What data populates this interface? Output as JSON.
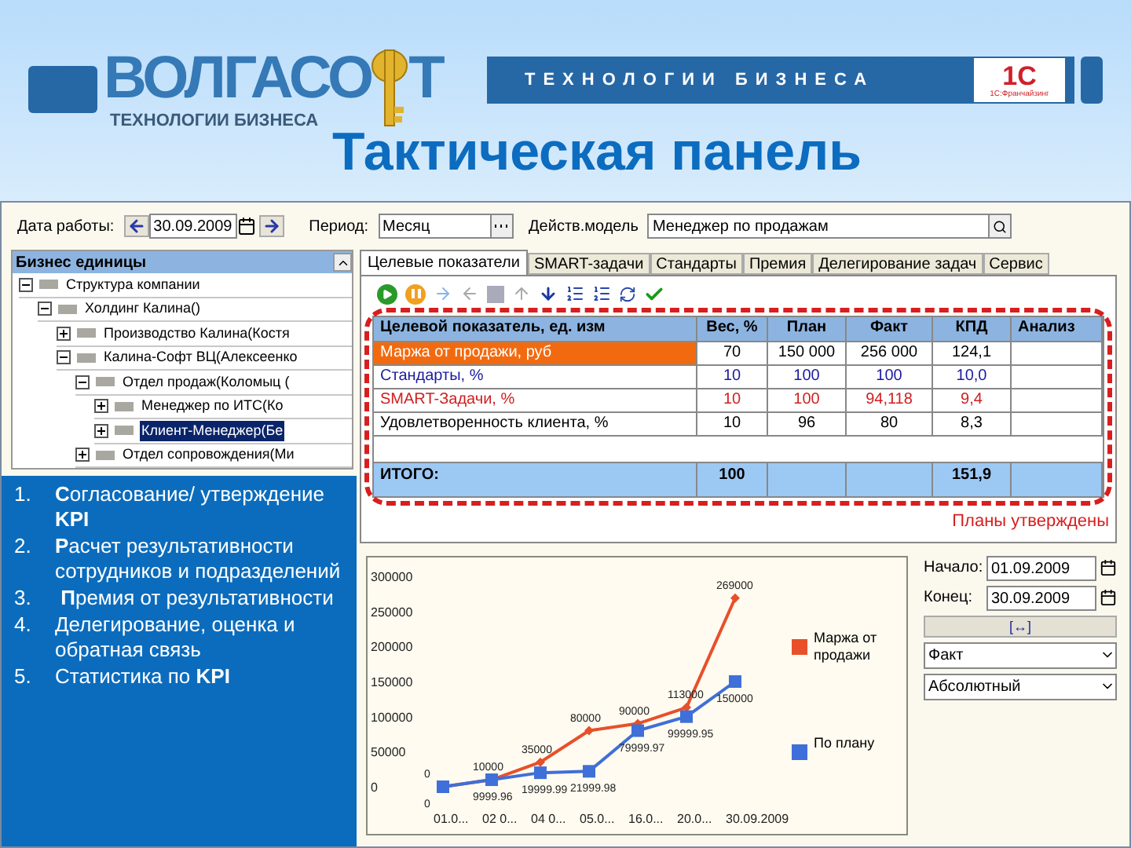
{
  "banner": {
    "logo_left": "ВОЛГАСО",
    "logo_right": "Т",
    "logo_tagline": "ТЕХНОЛОГИИ БИЗНЕСА",
    "bar_text": "ТЕХНОЛОГИИ БИЗНЕСА",
    "partner_logo": "1С",
    "partner_caption": "1С:Франчайзинг"
  },
  "title": "Тактическая панель",
  "filters": {
    "date_label": "Дата работы:",
    "date_value": "30.09.2009",
    "period_label": "Период:",
    "period_value": "Месяц",
    "model_label": "Действ.модель",
    "model_value": "Менеджер по продажам"
  },
  "tree": {
    "header": "Бизнес единицы",
    "items": [
      {
        "label": "Структура компании",
        "expanded": true,
        "selected": false,
        "children": [
          {
            "label": "Холдинг Калина()",
            "expanded": true,
            "selected": false,
            "children": [
              {
                "label": "Производство Калина(Костя",
                "expanded": false,
                "selected": false
              },
              {
                "label": "Калина-Софт ВЦ(Алексеенко",
                "expanded": true,
                "selected": false,
                "children": [
                  {
                    "label": "Отдел продаж(Коломыц (",
                    "expanded": true,
                    "selected": false,
                    "children": [
                      {
                        "label": "Менеджер по ИТС(Ко",
                        "expanded": false,
                        "selected": false
                      },
                      {
                        "label": "Клиент-Менеджер(Бе",
                        "expanded": false,
                        "selected": true
                      }
                    ]
                  },
                  {
                    "label": "Отдел сопровождения(Ми",
                    "expanded": false,
                    "selected": false
                  }
                ]
              }
            ]
          }
        ]
      }
    ]
  },
  "steps": [
    {
      "number": "1.",
      "text": "**С**огласование/ утверждение **KPI**"
    },
    {
      "number": "2.",
      "text": "**Р**асчет результативности сотрудников и подразделений"
    },
    {
      "number": "3.",
      "text": " **П**ремия от результативности"
    },
    {
      "number": "4.",
      "text": "Делегирование, оценка и обратная связь"
    },
    {
      "number": "5.",
      "text": "Статистика по **KPI**"
    }
  ],
  "tabs": [
    {
      "label": "Целевые показатели",
      "selected": true
    },
    {
      "label": "SMART-задачи",
      "selected": false
    },
    {
      "label": "Стандарты",
      "selected": false
    },
    {
      "label": "Премия",
      "selected": false
    },
    {
      "label": "Делегирование задач",
      "selected": false
    },
    {
      "label": "Сервис",
      "selected": false
    }
  ],
  "table": {
    "columns": [
      "Целевой показатель, ед. изм",
      "Вес, %",
      "План",
      "Факт",
      "КПД",
      "Анализ"
    ],
    "rows": [
      {
        "cells": [
          "Маржа от продажи, руб",
          "70",
          "150 000",
          "256 000",
          "124,1",
          ""
        ],
        "color": "#000000",
        "selected": true
      },
      {
        "cells": [
          "Стандарты, %",
          "10",
          "100",
          "100",
          "10,0",
          ""
        ],
        "color": "#1a1aa0",
        "selected": false
      },
      {
        "cells": [
          "SMART-Задачи, %",
          "10",
          "100",
          "94,118",
          "9,4",
          ""
        ],
        "color": "#d02020",
        "selected": false
      },
      {
        "cells": [
          "Удовлетворенность клиента, %",
          "10",
          "96",
          "80",
          "8,3",
          ""
        ],
        "color": "#000000",
        "selected": false
      }
    ],
    "total": {
      "label": "ИТОГО:",
      "weight": "100",
      "kpd": "151,9"
    }
  },
  "status_text": "Планы утверждены",
  "chart_data": {
    "type": "line",
    "categories": [
      "01.0...",
      "02 0...",
      "04 0...",
      "05.0...",
      "16.0...",
      "20.0...",
      "30.09.2009"
    ],
    "ylim": [
      0,
      300000
    ],
    "yticks": [
      0,
      50000,
      100000,
      150000,
      200000,
      250000,
      300000
    ],
    "data_labels": true,
    "legend": "right",
    "series": [
      {
        "name": "Маржа от продажи",
        "color": "#e8502a",
        "marker": "diamond",
        "values": [
          0,
          10000,
          35000,
          80000,
          90000,
          113000,
          269000
        ]
      },
      {
        "name": "По плану",
        "color": "#3f6fd8",
        "marker": "square",
        "values": [
          0,
          9999.96,
          19999.99,
          21999.98,
          79999.97,
          99999.95,
          150000
        ]
      }
    ]
  },
  "chart_controls": {
    "start_label": "Начало:",
    "start_value": "01.09.2009",
    "end_label": "Конец:",
    "end_value": "30.09.2009",
    "range_button": "[↔]",
    "measure": "Факт",
    "mode": "Абсолютный"
  }
}
